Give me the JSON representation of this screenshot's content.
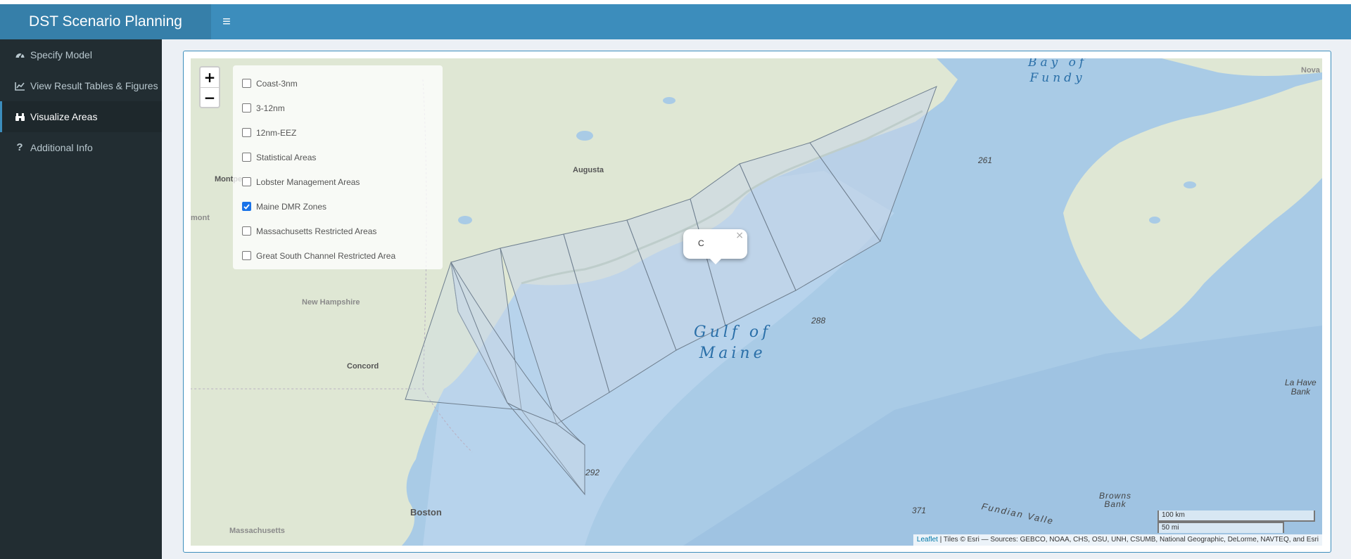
{
  "header": {
    "title": "DST Scenario Planning",
    "menu_glyph": "≡"
  },
  "sidebar": {
    "items": [
      {
        "label": "Specify Model",
        "icon": "dashboard-icon",
        "active": false
      },
      {
        "label": "View Result Tables & Figures",
        "icon": "line-chart-icon",
        "active": false
      },
      {
        "label": "Visualize Areas",
        "icon": "binoculars-icon",
        "active": true
      },
      {
        "label": "Additional Info",
        "icon": "question-icon",
        "active": false
      }
    ]
  },
  "map": {
    "zoom_in": "+",
    "zoom_out": "−",
    "layers": [
      {
        "label": "Coast-3nm",
        "checked": false
      },
      {
        "label": "3-12nm",
        "checked": false
      },
      {
        "label": "12nm-EEZ",
        "checked": false
      },
      {
        "label": "Statistical Areas",
        "checked": false
      },
      {
        "label": "Lobster Management Areas",
        "checked": false
      },
      {
        "label": "Maine DMR Zones",
        "checked": true
      },
      {
        "label": "Massachusetts Restricted Areas",
        "checked": false
      },
      {
        "label": "Great South Channel Restricted Area",
        "checked": false
      }
    ],
    "popup": {
      "text": "C",
      "close": "×"
    },
    "labels": {
      "bay_line1": "Bay of",
      "bay_line2": "Fundy",
      "gulf_line1": "Gulf of",
      "gulf_line2": "Maine",
      "augusta": "Augusta",
      "montpelier": "Montpe",
      "vermont": "mont",
      "new_hampshire": "New Hampshire",
      "concord": "Concord",
      "boston": "Boston",
      "massachusetts": "Massachusetts",
      "depth_261": "261",
      "depth_288": "288",
      "depth_292": "292",
      "depth_371": "371",
      "fundian": "Fundian Valle",
      "browns_line1": "Browns",
      "browns_line2": "Bank",
      "lahave_line1": "La Have",
      "lahave_line2": "Bank",
      "nova": "Nova"
    },
    "scale": {
      "km": "100 km",
      "mi": "50 mi"
    },
    "attribution": {
      "leaflet": "Leaflet",
      "text": " | Tiles © Esri — Sources: GEBCO, NOAA, CHS, OSU, UNH, CSUMB, National Geographic, DeLorme, NAVTEQ, and Esri"
    }
  },
  "colors": {
    "header": "#3c8dbc",
    "logo": "#367fa9",
    "sidebar": "#222d32",
    "water": "#a9cbe6",
    "land": "#dfe7d4",
    "zone_fill": "#c7d6e8"
  }
}
